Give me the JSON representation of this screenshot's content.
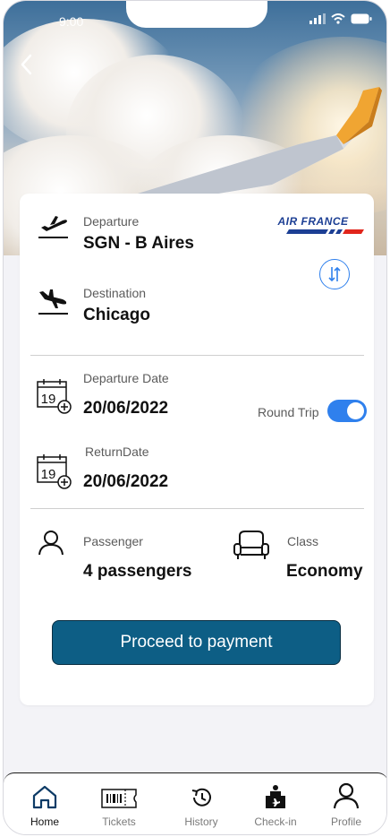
{
  "status_bar": {
    "time": "9:00"
  },
  "airline": {
    "logo_text": "AIR FRANCE"
  },
  "departure": {
    "label": "Departure",
    "value": "SGN - B Aires"
  },
  "destination": {
    "label": "Destination",
    "value": "Chicago"
  },
  "departure_date": {
    "label": "Departure Date",
    "value": "20/06/2022",
    "icon_day": "19"
  },
  "round_trip": {
    "label": "Round Trip",
    "enabled": true
  },
  "return_date": {
    "label": "ReturnDate",
    "value": "20/06/2022",
    "icon_day": "19"
  },
  "passenger": {
    "label": "Passenger",
    "value": "4 passengers"
  },
  "class": {
    "label": "Class",
    "value": "Economy"
  },
  "proceed_button": {
    "label": "Proceed to payment"
  },
  "colors": {
    "accent": "#2f80ed",
    "button": "#0d5e85",
    "logo_blue": "#1c3f94",
    "logo_red": "#e1251b"
  },
  "bottom_nav": {
    "items": [
      {
        "label": "Home",
        "icon": "home-icon",
        "active": true
      },
      {
        "label": "Tickets",
        "icon": "ticket-icon",
        "active": false
      },
      {
        "label": "History",
        "icon": "history-icon",
        "active": false
      },
      {
        "label": "Check-in",
        "icon": "check-in-icon",
        "active": false
      },
      {
        "label": "Profile",
        "icon": "profile-icon",
        "active": false
      }
    ]
  }
}
